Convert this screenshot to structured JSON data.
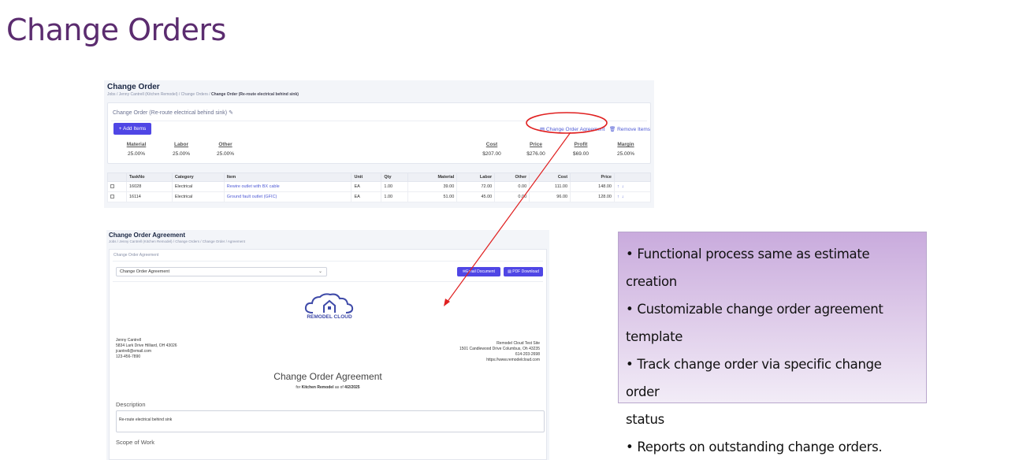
{
  "slide": {
    "title": "Change Orders"
  },
  "change_order_screen": {
    "title": "Change Order",
    "breadcrumb": [
      "Jobs",
      "Jenny Cantrell (Kitchen Remodel)",
      "Change Orders",
      "Change Order (Re-route electrical behind sink)"
    ],
    "change_order_name": "Change Order (Re-route electrical behind sink)",
    "add_items_label": "+ Add Items",
    "agreement_link_label": "Change Order Agreement",
    "remove_items_label": "Remove Items",
    "stats": {
      "material": {
        "label": "Material",
        "value": "25.00%"
      },
      "labor": {
        "label": "Labor",
        "value": "25.00%"
      },
      "other": {
        "label": "Other",
        "value": "25.00%"
      },
      "cost": {
        "label": "Cost",
        "value": "$207.00"
      },
      "price": {
        "label": "Price",
        "value": "$276.00"
      },
      "profit": {
        "label": "Profit",
        "value": "$69.00"
      },
      "margin": {
        "label": "Margin",
        "value": "25.00%"
      }
    },
    "table": {
      "headers": [
        "TaskNo",
        "Category",
        "Item",
        "Unit",
        "Qty",
        "Material",
        "Labor",
        "Other",
        "Cost",
        "Price"
      ],
      "rows": [
        {
          "task": "16028",
          "category": "Electrical",
          "item": "Rewire outlet with BX cable",
          "unit": "EA",
          "qty": "1.00",
          "material": "39.00",
          "labor": "72.00",
          "other": "0.00",
          "cost": "111.00",
          "price": "148.00"
        },
        {
          "task": "16114",
          "category": "Electrical",
          "item": "Ground fault outlet (GFIC)",
          "unit": "EA",
          "qty": "1.00",
          "material": "51.00",
          "labor": "45.00",
          "other": "0.00",
          "cost": "96.00",
          "price": "128.00"
        }
      ],
      "up_arrow": "↑",
      "down_arrow": "↓"
    }
  },
  "agreement_screen": {
    "title": "Change Order Agreement",
    "breadcrumb": "Jobs / Jenny Cantrell (Kitchen Remodel) / Change Orders / Change Order / Agreement",
    "sub_label": "Change Order Agreement",
    "template_select": "Change Order Agreement",
    "email_button": "Email Document",
    "pdf_button": "PDF Download",
    "logo_text": "REMODEL CLOUD",
    "customer": {
      "name": "Jenny Cantrell",
      "address": "5834 Lark Drive Hilliard, OH 43026",
      "email": "jcantrell@email.com",
      "phone": "123-456-7890"
    },
    "company": {
      "name": "Remodel Cloud Test Site",
      "address": "1501 Candlewood Drive Columbus, Oh 43235",
      "phone": "614-203-2698",
      "website": "https://www.remodelcloud.com"
    },
    "doc_title": "Change Order Agreement",
    "doc_sub_prefix": "for",
    "doc_sub_project": "Kitchen Remodel",
    "doc_sub_mid": "as of",
    "doc_sub_date": "4/2/2025",
    "description_heading": "Description",
    "description_text": "Re-route electrical behind sink",
    "scope_heading": "Scope of Work"
  },
  "callout": {
    "bullets": [
      "• Functional process same as estimate creation",
      "• Customizable change order agreement",
      "template",
      "• Track change order via specific change order",
      "status",
      "• Reports on outstanding change orders."
    ]
  },
  "colors": {
    "title": "#5b2c6f",
    "accent_button": "#4f46e5",
    "link": "#4f5bd5",
    "annotation": "#e02020"
  }
}
